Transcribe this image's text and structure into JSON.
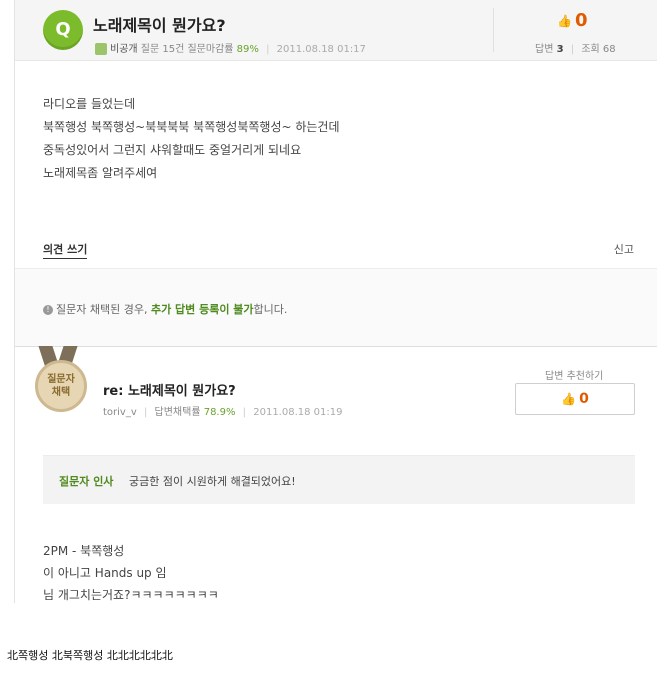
{
  "question": {
    "badge": "Q",
    "title": "노래제목이 뭔가요?",
    "author": "비공개",
    "stats": "질문 15건 질문마감률",
    "close_rate": "89%",
    "date": "2011.08.18 01:17",
    "recommend_count": "0",
    "answers_label": "답변",
    "answers_count": "3",
    "views_label": "조회",
    "views_count": "68",
    "body": [
      "라디오를 들었는데",
      "북쪽행성 북쪽행성~북북북북 북쪽행성북쪽행성~ 하는건데",
      "중독성있어서 그런지 샤워할때도 중얼거리게 되네요",
      "노래제목좀 알려주세여"
    ],
    "opinion_link": "의견 쓰기",
    "report_link": "신고",
    "notice_prefix": "질문자 채택된 경우,",
    "notice_highlight": "추가 답변 등록이 불가",
    "notice_suffix": "합니다."
  },
  "answer": {
    "medal_line1": "질문자",
    "medal_line2": "채택",
    "title": "re: 노래제목이 뭔가요?",
    "author": "toriv_v",
    "rate_label": "답변채택률",
    "rate": "78.9%",
    "date": "2011.08.18 01:19",
    "recommend_label": "답변 추천하기",
    "recommend_count": "0",
    "greeting_label": "질문자 인사",
    "greeting": "궁금한 점이 시원하게 해결되었어요!",
    "body": [
      "2PM - 북쪽행성",
      "이 아니고 Hands up 임",
      "님 개그치는거죠?ㅋㅋㅋㅋㅋㅋㅋㅋ"
    ]
  },
  "caption": "北쪽행성 北북쪽행성 北北北北北北",
  "colors": {
    "accent_green": "#7cbb2c",
    "recommend_orange": "#e05a00"
  }
}
